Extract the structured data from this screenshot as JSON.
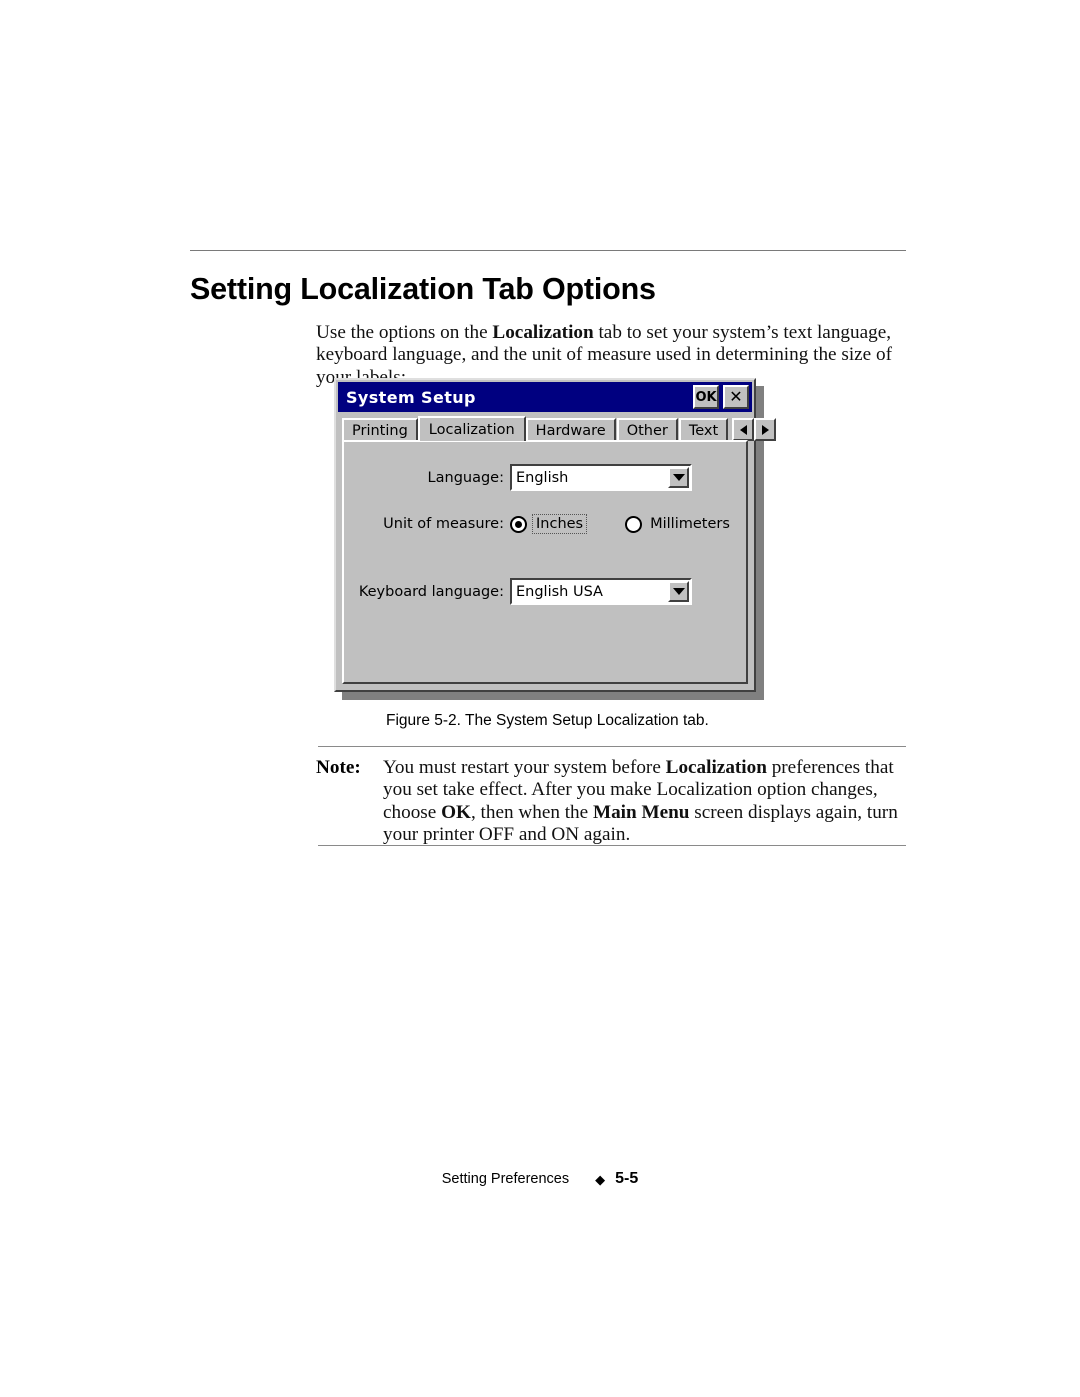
{
  "page": {
    "title": "Setting Localization Tab Options",
    "intro": {
      "part1": "Use the options on the ",
      "bold1": "Localization",
      "part2": " tab to set your system’s text language, keyboard language, and the unit of measure used in determining the size of your labels:"
    },
    "figure_caption": "Figure 5-2. The System Setup Localization tab.",
    "note": {
      "label": "Note:",
      "part1": "You must restart your system before ",
      "bold1": "Localization",
      "part2": " preferences that you set take effect. After you make Localization option changes, choose ",
      "bold2": "OK",
      "part3": ", then when the ",
      "bold3": "Main Menu",
      "part4": " screen displays again, turn your printer OFF and ON again."
    },
    "footer": {
      "section": "Setting Preferences",
      "diamond": "◆",
      "page_number": "5-5"
    }
  },
  "dialog": {
    "title": "System Setup",
    "titlebar_buttons": {
      "ok_label": "OK",
      "close_label": "✕"
    },
    "tabs": [
      {
        "label": "Printing",
        "active": false
      },
      {
        "label": "Localization",
        "active": true
      },
      {
        "label": "Hardware",
        "active": false
      },
      {
        "label": "Other",
        "active": false
      },
      {
        "label": "Text",
        "active": false
      }
    ],
    "tab_scroll": {
      "left_label": "◀",
      "right_label": "▶"
    },
    "fields": {
      "language": {
        "label": "Language:",
        "value": "English"
      },
      "unit_of_measure": {
        "label": "Unit of measure:",
        "options": [
          {
            "label": "Inches",
            "selected": true,
            "focused": true
          },
          {
            "label": "Millimeters",
            "selected": false,
            "focused": false
          }
        ]
      },
      "keyboard_language": {
        "label": "Keyboard language:",
        "value": "English USA"
      }
    },
    "colors": {
      "titlebar": "#000080",
      "face": "#c0c0c0",
      "shadow": "#808080",
      "field": "#ffffff"
    }
  }
}
